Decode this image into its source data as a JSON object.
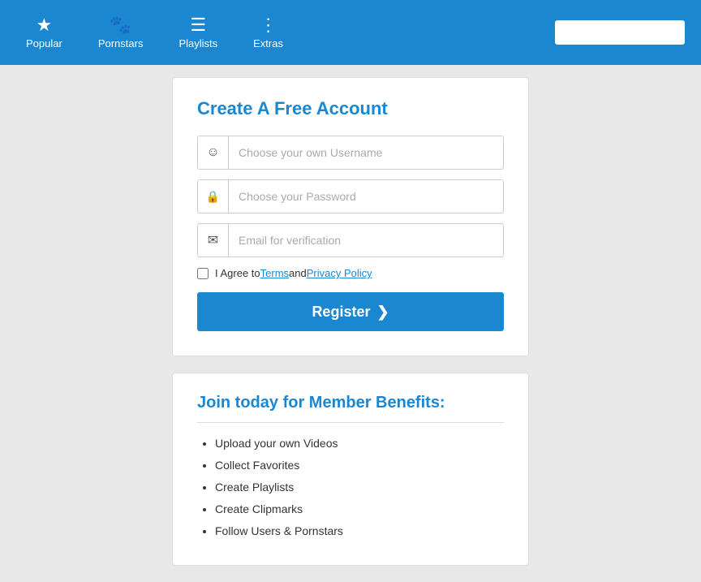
{
  "navbar": {
    "items": [
      {
        "id": "popular",
        "label": "Popular",
        "icon": "★"
      },
      {
        "id": "pornstars",
        "label": "Pornstars",
        "icon": "🐾"
      },
      {
        "id": "playlists",
        "label": "Playlists",
        "icon": "☰"
      },
      {
        "id": "extras",
        "label": "Extras",
        "icon": "⋮"
      }
    ],
    "search_placeholder": ""
  },
  "register": {
    "title": "Create A Free Account",
    "username_placeholder": "Choose your own Username",
    "password_placeholder": "Choose your Password",
    "email_placeholder": "Email for verification",
    "agree_text": "I Agree to ",
    "terms_label": "Terms",
    "and_text": " and ",
    "privacy_label": "Privacy Policy",
    "register_label": "Register",
    "register_arrow": "❯"
  },
  "benefits": {
    "title": "Join today for Member Benefits:",
    "items": [
      "Upload your own Videos",
      "Collect Favorites",
      "Create Playlists",
      "Create Clipmarks",
      "Follow Users & Pornstars"
    ]
  }
}
